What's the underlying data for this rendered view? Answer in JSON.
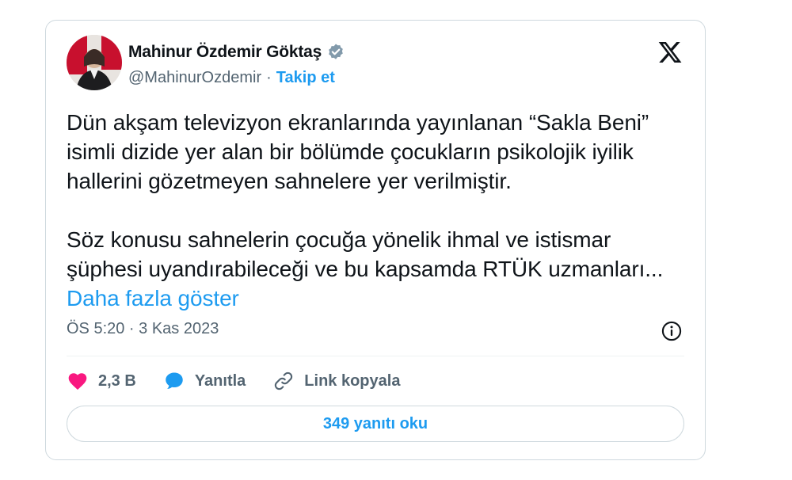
{
  "author": {
    "display_name": "Mahinur Özdemir Göktaş",
    "handle": "@MahinurOzdemir",
    "separator": "·",
    "follow_label": "Takip et"
  },
  "tweet": {
    "paragraph_1": "Dün akşam televizyon ekranlarında yayınlanan “Sakla Beni” isimli dizide yer alan bir bölümde çocukların psikolojik iyilik hallerini gözetmeyen sahnelere yer verilmiştir.",
    "paragraph_2": "Söz konusu sahnelerin çocuğa yönelik ihmal ve istismar şüphesi uyandırabileceği ve bu kapsamda RTÜK uzmanları... ",
    "show_more": "Daha fazla göster",
    "timestamp": "ÖS 5:20 · 3 Kas 2023"
  },
  "actions": {
    "likes": "2,3 B",
    "reply_label": "Yanıtla",
    "copy_link_label": "Link kopyala"
  },
  "read_replies_label": "349 yanıtı oku",
  "colors": {
    "accent": "#1d9bf0",
    "like": "#f91880",
    "secondary_text": "#536471",
    "border": "#cfd9de"
  },
  "icons": [
    "verified-badge-icon",
    "x-logo-icon",
    "info-icon",
    "heart-icon",
    "reply-bubble-icon",
    "link-icon"
  ]
}
